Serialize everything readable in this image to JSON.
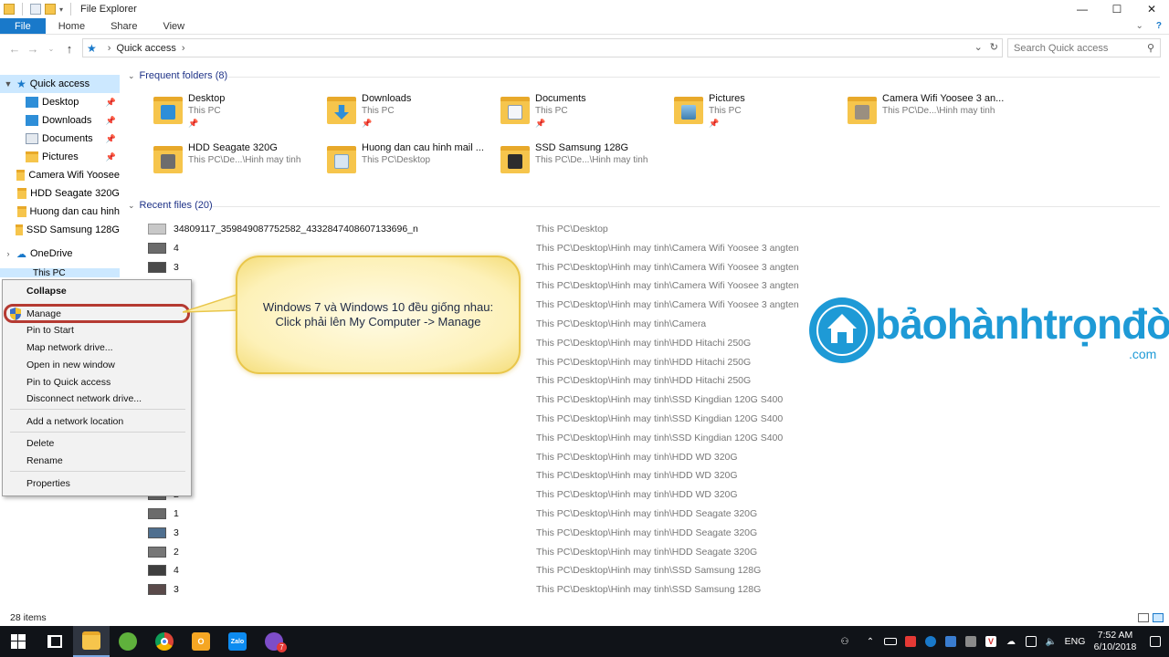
{
  "window": {
    "title": "File Explorer",
    "controls": {
      "minimize": "—",
      "maximize": "☐",
      "close": "✕"
    }
  },
  "ribbon": {
    "tabs": [
      "File",
      "Home",
      "Share",
      "View"
    ],
    "expand_icon": "chevron-down-icon",
    "help_icon": "help-icon"
  },
  "address": {
    "path": "Quick access",
    "search_placeholder": "Search Quick access"
  },
  "navpane": {
    "quick_access": "Quick access",
    "items": [
      {
        "label": "Desktop",
        "pinned": true
      },
      {
        "label": "Downloads",
        "pinned": true
      },
      {
        "label": "Documents",
        "pinned": true
      },
      {
        "label": "Pictures",
        "pinned": true
      },
      {
        "label": "Camera Wifi Yoosee",
        "pinned": false
      },
      {
        "label": "HDD Seagate 320G",
        "pinned": false
      },
      {
        "label": "Huong dan cau hinh",
        "pinned": false
      },
      {
        "label": "SSD Samsung 128G",
        "pinned": false
      }
    ],
    "onedrive": "OneDrive",
    "this_pc": "This PC"
  },
  "frequent": {
    "header": "Frequent folders (8)",
    "folders": [
      {
        "name": "Desktop",
        "sub": "This PC",
        "pinned": true
      },
      {
        "name": "Downloads",
        "sub": "This PC",
        "pinned": true
      },
      {
        "name": "Documents",
        "sub": "This PC",
        "pinned": true
      },
      {
        "name": "Pictures",
        "sub": "This PC",
        "pinned": true
      },
      {
        "name": "Camera Wifi Yoosee 3 an...",
        "sub": "This PC\\De...\\Hinh may tinh",
        "pinned": false
      },
      {
        "name": "HDD Seagate 320G",
        "sub": "This PC\\De...\\Hinh may tinh",
        "pinned": false
      },
      {
        "name": "Huong dan cau hinh mail ...",
        "sub": "This PC\\Desktop",
        "pinned": false
      },
      {
        "name": "SSD Samsung 128G",
        "sub": "This PC\\De...\\Hinh may tinh",
        "pinned": false
      }
    ]
  },
  "recent": {
    "header": "Recent files (20)",
    "files": [
      {
        "name": "34809117_359849087752582_4332847408607133696_n",
        "location": "This PC\\Desktop"
      },
      {
        "name": "4",
        "location": "This PC\\Desktop\\Hinh may tinh\\Camera Wifi Yoosee 3 angten"
      },
      {
        "name": "3",
        "location": "This PC\\Desktop\\Hinh may tinh\\Camera Wifi Yoosee 3 angten"
      },
      {
        "name": "",
        "location": "This PC\\Desktop\\Hinh may tinh\\Camera Wifi Yoosee 3 angten"
      },
      {
        "name": "",
        "location": "This PC\\Desktop\\Hinh may tinh\\Camera Wifi Yoosee 3 angten"
      },
      {
        "name": "",
        "location": "This PC\\Desktop\\Hinh may tinh\\Camera"
      },
      {
        "name": "",
        "location": "This PC\\Desktop\\Hinh may tinh\\HDD Hitachi 250G"
      },
      {
        "name": "",
        "location": "This PC\\Desktop\\Hinh may tinh\\HDD Hitachi 250G"
      },
      {
        "name": "",
        "location": "This PC\\Desktop\\Hinh may tinh\\HDD Hitachi 250G"
      },
      {
        "name": "",
        "location": "This PC\\Desktop\\Hinh may tinh\\SSD Kingdian 120G S400"
      },
      {
        "name": "",
        "location": "This PC\\Desktop\\Hinh may tinh\\SSD Kingdian 120G S400"
      },
      {
        "name": "",
        "location": "This PC\\Desktop\\Hinh may tinh\\SSD Kingdian 120G S400"
      },
      {
        "name": "",
        "location": "This PC\\Desktop\\Hinh may tinh\\HDD WD 320G"
      },
      {
        "name": "",
        "location": "This PC\\Desktop\\Hinh may tinh\\HDD WD 320G"
      },
      {
        "name": "2",
        "location": "This PC\\Desktop\\Hinh may tinh\\HDD WD 320G"
      },
      {
        "name": "1",
        "location": "This PC\\Desktop\\Hinh may tinh\\HDD Seagate 320G"
      },
      {
        "name": "3",
        "location": "This PC\\Desktop\\Hinh may tinh\\HDD Seagate 320G"
      },
      {
        "name": "2",
        "location": "This PC\\Desktop\\Hinh may tinh\\HDD Seagate 320G"
      },
      {
        "name": "4",
        "location": "This PC\\Desktop\\Hinh may tinh\\SSD Samsung 128G"
      },
      {
        "name": "3",
        "location": "This PC\\Desktop\\Hinh may tinh\\SSD Samsung 128G"
      }
    ]
  },
  "context_menu": {
    "items": [
      "Collapse",
      "Manage",
      "Pin to Start",
      "Map network drive...",
      "Open in new window",
      "Pin to Quick access",
      "Disconnect network drive...",
      "Add a network location",
      "Delete",
      "Rename",
      "Properties"
    ]
  },
  "callout": {
    "line1": "Windows 7 và Windows 10 đều giống nhau:",
    "line2": "Click phải lên My Computer -> Manage"
  },
  "logo": {
    "text": "bảohànhtrọnđời",
    "suffix": ".com"
  },
  "status": {
    "item_count": "28 items"
  },
  "taskbar": {
    "lang": "ENG",
    "time": "7:52 AM",
    "date": "6/10/2018",
    "viber_badge": "7",
    "zalo_label": "Zalo"
  },
  "colors": {
    "accent": "#1979ca",
    "selection": "#cce8ff",
    "highlight_ring": "#b53a32",
    "logo": "#1e9ad6",
    "taskbar": "#101318"
  }
}
